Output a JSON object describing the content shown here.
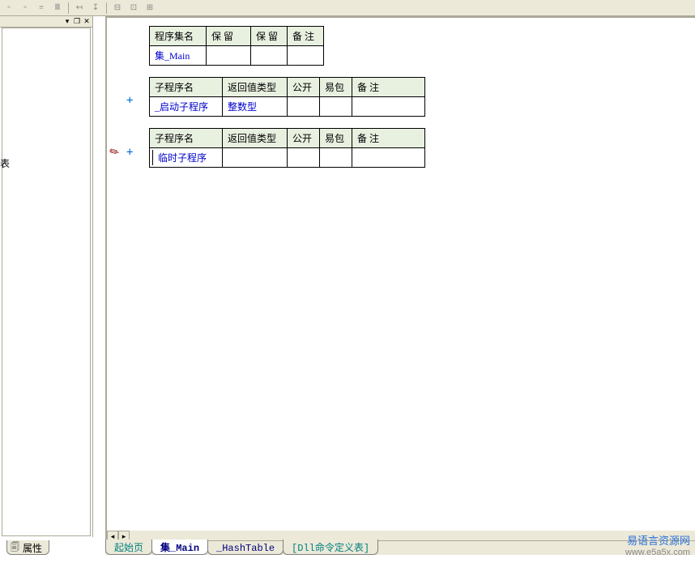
{
  "left_panel": {
    "cut_text": "表"
  },
  "table1": {
    "headers": [
      "程序集名",
      "保 留",
      "保 留",
      "备 注"
    ],
    "row": {
      "name": "集_Main",
      "r1": "",
      "r2": "",
      "note": ""
    }
  },
  "table2": {
    "headers": [
      "子程序名",
      "返回值类型",
      "公开",
      "易包",
      "备 注"
    ],
    "row": {
      "name": "_启动子程序",
      "ret": "整数型",
      "pub": "",
      "pkg": "",
      "note": ""
    }
  },
  "table3": {
    "headers": [
      "子程序名",
      "返回值类型",
      "公开",
      "易包",
      "备 注"
    ],
    "row": {
      "name": "临时子程序",
      "ret": "",
      "pub": "",
      "pkg": "",
      "note": ""
    }
  },
  "main_tabs": {
    "t0": "起始页",
    "t1": "集_Main",
    "t2": "_HashTable",
    "t3": "[Dll命令定义表]"
  },
  "prop_tab": {
    "label": "属性"
  },
  "watermark": {
    "l1": "易语言资源网",
    "l2": "www.e5a5x.com"
  }
}
